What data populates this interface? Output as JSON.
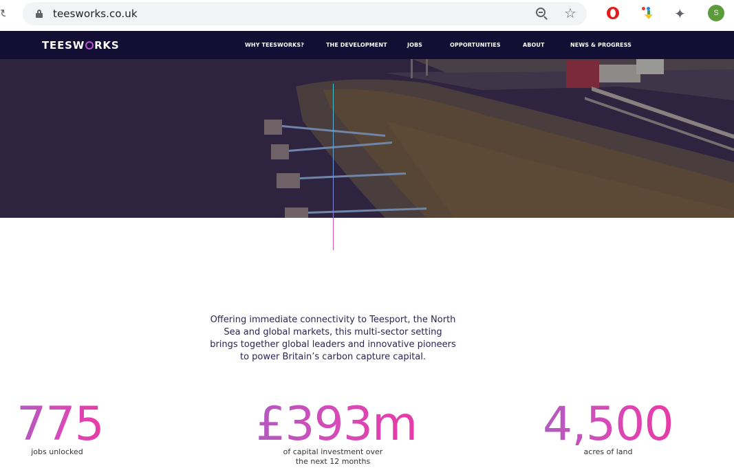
{
  "browser": {
    "url": "teesworks.co.uk",
    "profile_initial": "S"
  },
  "nav": {
    "logo_left": "TEESW",
    "logo_right": "RKS",
    "items": [
      {
        "label": "WHY TEESWORKS?"
      },
      {
        "label": "THE DEVELOPMENT"
      },
      {
        "label": "JOBS"
      },
      {
        "label": "OPPORTUNITIES"
      },
      {
        "label": "ABOUT"
      },
      {
        "label": "NEWS & PROGRESS"
      }
    ]
  },
  "intro": {
    "text": "Offering immediate connectivity to Teesport, the North Sea and global markets, this multi-sector setting brings together global leaders and innovative pioneers to power Britain’s carbon capture capital."
  },
  "stats": [
    {
      "value": "775",
      "label": "jobs unlocked"
    },
    {
      "value": "£393m",
      "label": "of capital investment over the next 12 months"
    },
    {
      "value": "4,500",
      "label": "acres of land"
    }
  ],
  "colors": {
    "nav_bg": "#130e33",
    "accent_pink": "#e83aa6",
    "accent_purple": "#b15ac0",
    "accent_cyan": "#3bc6d6"
  }
}
